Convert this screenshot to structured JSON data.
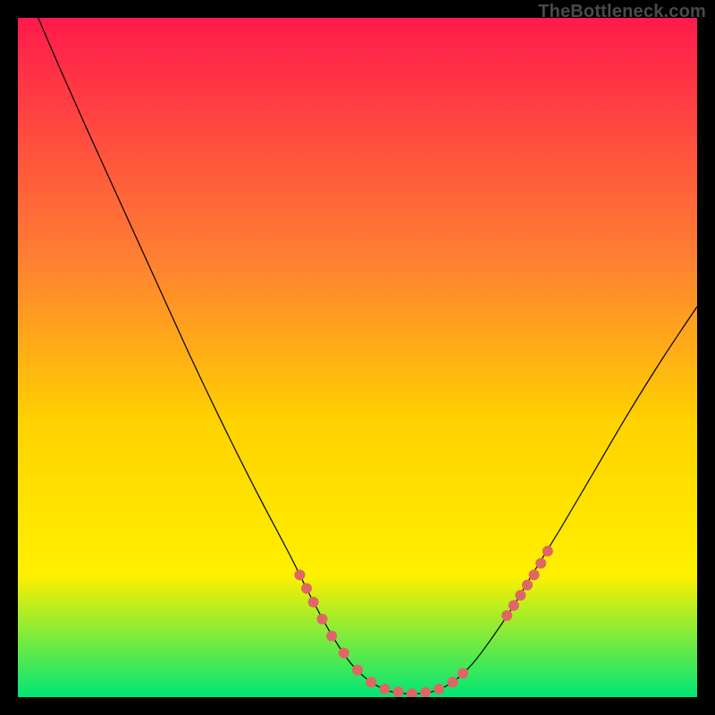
{
  "watermark": "TheBottleneck.com",
  "chart_data": {
    "type": "line",
    "title": "",
    "xlabel": "",
    "ylabel": "",
    "xlim": [
      0,
      100
    ],
    "ylim": [
      0,
      100
    ],
    "background_gradient": {
      "top": "#ff1a4b",
      "mid1": "#ff7e33",
      "mid2": "#ffd300",
      "mid3": "#fff000",
      "bottom": "#00e676"
    },
    "curve": {
      "color": "#000000",
      "width": 1.2,
      "points": [
        {
          "x": 3.0,
          "y": 100.0
        },
        {
          "x": 6.0,
          "y": 93.0
        },
        {
          "x": 10.0,
          "y": 84.0
        },
        {
          "x": 15.0,
          "y": 73.0
        },
        {
          "x": 20.0,
          "y": 62.0
        },
        {
          "x": 25.0,
          "y": 51.0
        },
        {
          "x": 30.0,
          "y": 40.5
        },
        {
          "x": 35.0,
          "y": 30.5
        },
        {
          "x": 40.0,
          "y": 21.0
        },
        {
          "x": 43.0,
          "y": 15.0
        },
        {
          "x": 46.0,
          "y": 9.5
        },
        {
          "x": 49.0,
          "y": 5.0
        },
        {
          "x": 52.0,
          "y": 2.2
        },
        {
          "x": 55.0,
          "y": 0.8
        },
        {
          "x": 58.0,
          "y": 0.5
        },
        {
          "x": 61.0,
          "y": 0.8
        },
        {
          "x": 64.0,
          "y": 2.2
        },
        {
          "x": 67.0,
          "y": 5.0
        },
        {
          "x": 70.0,
          "y": 9.0
        },
        {
          "x": 73.0,
          "y": 13.5
        },
        {
          "x": 76.0,
          "y": 18.5
        },
        {
          "x": 80.0,
          "y": 25.0
        },
        {
          "x": 85.0,
          "y": 33.5
        },
        {
          "x": 90.0,
          "y": 42.0
        },
        {
          "x": 95.0,
          "y": 50.0
        },
        {
          "x": 100.0,
          "y": 57.5
        }
      ]
    },
    "markers_left": {
      "color": "#e06666",
      "radius": 6,
      "points": [
        {
          "x": 41.5,
          "y": 18.0
        },
        {
          "x": 42.5,
          "y": 16.0
        },
        {
          "x": 43.5,
          "y": 14.0
        },
        {
          "x": 44.8,
          "y": 11.5
        },
        {
          "x": 46.2,
          "y": 9.0
        },
        {
          "x": 48.0,
          "y": 6.5
        },
        {
          "x": 50.0,
          "y": 4.0
        },
        {
          "x": 52.0,
          "y": 2.2
        },
        {
          "x": 54.0,
          "y": 1.2
        },
        {
          "x": 56.0,
          "y": 0.8
        },
        {
          "x": 58.0,
          "y": 0.5
        },
        {
          "x": 60.0,
          "y": 0.7
        },
        {
          "x": 62.0,
          "y": 1.2
        },
        {
          "x": 64.0,
          "y": 2.2
        },
        {
          "x": 65.5,
          "y": 3.5
        }
      ]
    },
    "markers_right": {
      "color": "#e06666",
      "radius": 6,
      "points": [
        {
          "x": 72.0,
          "y": 12.0
        },
        {
          "x": 73.0,
          "y": 13.5
        },
        {
          "x": 74.0,
          "y": 15.0
        },
        {
          "x": 75.0,
          "y": 16.5
        },
        {
          "x": 76.0,
          "y": 18.0
        },
        {
          "x": 77.0,
          "y": 19.7
        },
        {
          "x": 78.0,
          "y": 21.5
        }
      ]
    }
  }
}
